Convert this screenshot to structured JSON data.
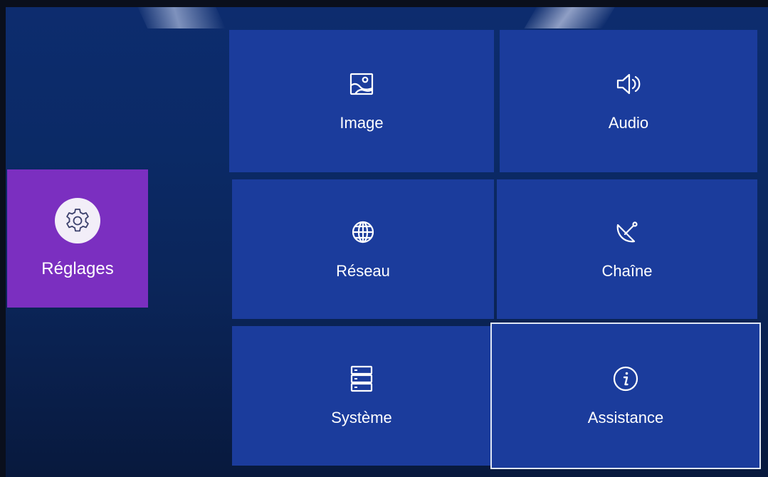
{
  "sidebar": {
    "label": "Réglages",
    "icon": "gear-icon",
    "color": "#7b2fc0"
  },
  "menu": {
    "tile_color": "#1b3c9c",
    "items": [
      {
        "label": "Image",
        "icon": "picture-icon"
      },
      {
        "label": "Audio",
        "icon": "speaker-icon"
      },
      {
        "label": "Réseau",
        "icon": "globe-icon"
      },
      {
        "label": "Chaîne",
        "icon": "satellite-dish-icon"
      },
      {
        "label": "Système",
        "icon": "server-icon"
      },
      {
        "label": "Assistance",
        "icon": "info-icon",
        "selected": true
      }
    ]
  }
}
